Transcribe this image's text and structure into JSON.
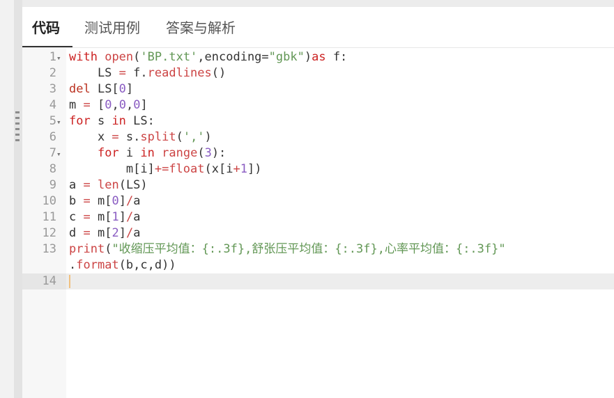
{
  "tabs": [
    {
      "label": "代码",
      "active": true
    },
    {
      "label": "测试用例",
      "active": false
    },
    {
      "label": "答案与解析",
      "active": false
    }
  ],
  "editor": {
    "active_line": 14,
    "lines": [
      {
        "n": "1",
        "fold": true
      },
      {
        "n": "2",
        "fold": false
      },
      {
        "n": "3",
        "fold": false
      },
      {
        "n": "4",
        "fold": false
      },
      {
        "n": "5",
        "fold": true
      },
      {
        "n": "6",
        "fold": false
      },
      {
        "n": "7",
        "fold": true
      },
      {
        "n": "8",
        "fold": false
      },
      {
        "n": "9",
        "fold": false
      },
      {
        "n": "10",
        "fold": false
      },
      {
        "n": "11",
        "fold": false
      },
      {
        "n": "12",
        "fold": false
      },
      {
        "n": "13",
        "fold": false
      },
      {
        "n": "",
        "fold": false
      },
      {
        "n": "14",
        "fold": false
      }
    ],
    "code": [
      [
        [
          "kw",
          "with"
        ],
        [
          "t",
          " "
        ],
        [
          "fn",
          "open"
        ],
        [
          "t",
          "("
        ],
        [
          "str",
          "'BP.txt'"
        ],
        [
          "t",
          ",encoding="
        ],
        [
          "str",
          "\"gbk\""
        ],
        [
          "t",
          ")"
        ],
        [
          "kw",
          "as"
        ],
        [
          "t",
          " f:"
        ]
      ],
      [
        [
          "t",
          "    LS "
        ],
        [
          "op",
          "="
        ],
        [
          "t",
          " f."
        ],
        [
          "fn",
          "readlines"
        ],
        [
          "t",
          "()"
        ]
      ],
      [
        [
          "kw2",
          "del"
        ],
        [
          "t",
          " LS["
        ],
        [
          "num",
          "0"
        ],
        [
          "t",
          "]"
        ]
      ],
      [
        [
          "t",
          "m "
        ],
        [
          "op",
          "="
        ],
        [
          "t",
          " ["
        ],
        [
          "num",
          "0"
        ],
        [
          "t",
          ","
        ],
        [
          "num",
          "0"
        ],
        [
          "t",
          ","
        ],
        [
          "num",
          "0"
        ],
        [
          "t",
          "]"
        ]
      ],
      [
        [
          "kw",
          "for"
        ],
        [
          "t",
          " s "
        ],
        [
          "kw",
          "in"
        ],
        [
          "t",
          " LS:"
        ]
      ],
      [
        [
          "t",
          "    x "
        ],
        [
          "op",
          "="
        ],
        [
          "t",
          " s."
        ],
        [
          "fn",
          "split"
        ],
        [
          "t",
          "("
        ],
        [
          "str",
          "','"
        ],
        [
          "t",
          ")"
        ]
      ],
      [
        [
          "t",
          "    "
        ],
        [
          "kw",
          "for"
        ],
        [
          "t",
          " i "
        ],
        [
          "kw",
          "in"
        ],
        [
          "t",
          " "
        ],
        [
          "fn",
          "range"
        ],
        [
          "t",
          "("
        ],
        [
          "num",
          "3"
        ],
        [
          "t",
          "):"
        ]
      ],
      [
        [
          "t",
          "        m[i]"
        ],
        [
          "op",
          "+="
        ],
        [
          "fn",
          "float"
        ],
        [
          "t",
          "(x[i"
        ],
        [
          "op",
          "+"
        ],
        [
          "num",
          "1"
        ],
        [
          "t",
          "])"
        ]
      ],
      [
        [
          "t",
          "a "
        ],
        [
          "op",
          "="
        ],
        [
          "t",
          " "
        ],
        [
          "fn",
          "len"
        ],
        [
          "t",
          "(LS)"
        ]
      ],
      [
        [
          "t",
          "b "
        ],
        [
          "op",
          "="
        ],
        [
          "t",
          " m["
        ],
        [
          "num",
          "0"
        ],
        [
          "t",
          "]"
        ],
        [
          "op",
          "/"
        ],
        [
          "t",
          "a"
        ]
      ],
      [
        [
          "t",
          "c "
        ],
        [
          "op",
          "="
        ],
        [
          "t",
          " m["
        ],
        [
          "num",
          "1"
        ],
        [
          "t",
          "]"
        ],
        [
          "op",
          "/"
        ],
        [
          "t",
          "a"
        ]
      ],
      [
        [
          "t",
          "d "
        ],
        [
          "op",
          "="
        ],
        [
          "t",
          " m["
        ],
        [
          "num",
          "2"
        ],
        [
          "t",
          "]"
        ],
        [
          "op",
          "/"
        ],
        [
          "t",
          "a"
        ]
      ],
      [
        [
          "fn",
          "print"
        ],
        [
          "t",
          "("
        ],
        [
          "str",
          "\"收缩压平均值：{:.3f},舒张压平均值：{:.3f},心率平均值：{:.3f}\""
        ]
      ],
      [
        [
          "t",
          "."
        ],
        [
          "fn",
          "format"
        ],
        [
          "t",
          "(b,c,d))"
        ]
      ],
      []
    ]
  }
}
